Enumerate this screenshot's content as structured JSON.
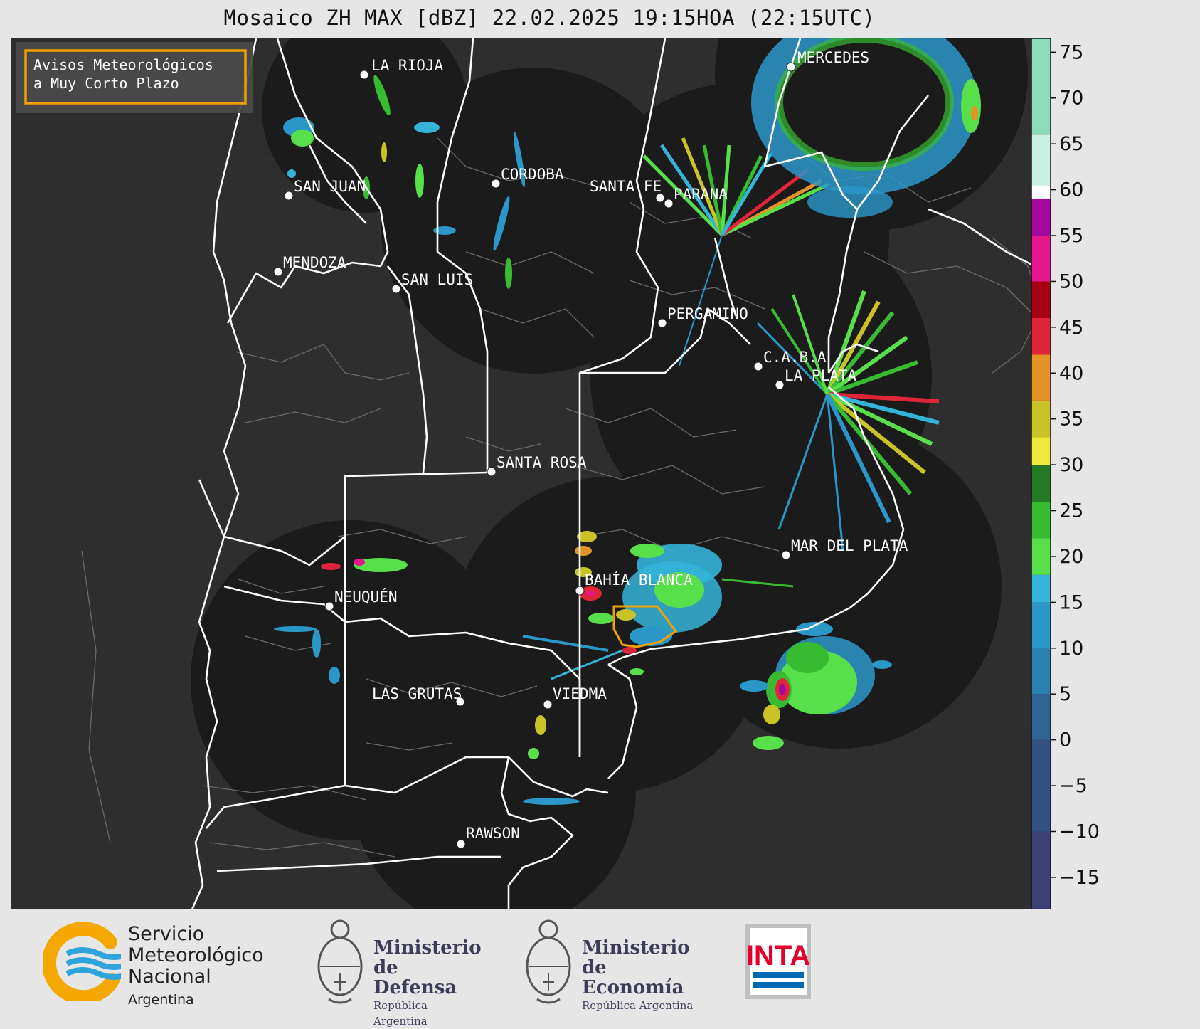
{
  "title": "Mosaico ZH MAX [dBZ] 22.02.2025 19:15HOA (22:15UTC)",
  "badge": {
    "line1": "Avisos Meteorológicos",
    "line2": "a Muy Corto Plazo",
    "color": "#f0a000"
  },
  "cities": [
    {
      "name": "LA RIOJA"
    },
    {
      "name": "SAN JUAN"
    },
    {
      "name": "CORDOBA"
    },
    {
      "name": "SANTA FE"
    },
    {
      "name": "PARANA"
    },
    {
      "name": "MERCEDES"
    },
    {
      "name": "MENDOZA"
    },
    {
      "name": "SAN LUIS"
    },
    {
      "name": "PERGAMINO"
    },
    {
      "name": "C.A.B.A"
    },
    {
      "name": "LA PLATA"
    },
    {
      "name": "SANTA ROSA"
    },
    {
      "name": "MAR DEL PLATA"
    },
    {
      "name": "BAHÍA BLANCA"
    },
    {
      "name": "NEUQUÉN"
    },
    {
      "name": "LAS GRUTAS"
    },
    {
      "name": "VIEDMA"
    },
    {
      "name": "RAWSON"
    }
  ],
  "colorbar": {
    "unit": "dBZ",
    "ticks": [
      "75",
      "70",
      "65",
      "60",
      "55",
      "50",
      "45",
      "40",
      "35",
      "30",
      "25",
      "20",
      "15",
      "10",
      "5",
      "0",
      "−5",
      "−10",
      "−15"
    ],
    "min": -18.5,
    "max": 76.5,
    "bands": [
      {
        "from": -18.5,
        "to": -10,
        "color": "#3b3f72"
      },
      {
        "from": -10,
        "to": 0,
        "color": "#34527f"
      },
      {
        "from": 0,
        "to": 5,
        "color": "#2f6594"
      },
      {
        "from": 5,
        "to": 10,
        "color": "#2c80b2"
      },
      {
        "from": 10,
        "to": 15,
        "color": "#2b97c9"
      },
      {
        "from": 15,
        "to": 18,
        "color": "#34b4d8"
      },
      {
        "from": 18,
        "to": 22,
        "color": "#58e04a"
      },
      {
        "from": 22,
        "to": 26,
        "color": "#37bb30"
      },
      {
        "from": 26,
        "to": 30,
        "color": "#237a22"
      },
      {
        "from": 30,
        "to": 33,
        "color": "#efe93a"
      },
      {
        "from": 33,
        "to": 37,
        "color": "#c9c327"
      },
      {
        "from": 37,
        "to": 42,
        "color": "#e39326"
      },
      {
        "from": 42,
        "to": 46,
        "color": "#e0243a"
      },
      {
        "from": 46,
        "to": 50,
        "color": "#a50014"
      },
      {
        "from": 50,
        "to": 55,
        "color": "#e6178c"
      },
      {
        "from": 55,
        "to": 59,
        "color": "#a5089f"
      },
      {
        "from": 59,
        "to": 60.5,
        "color": "#ffffff"
      },
      {
        "from": 60.5,
        "to": 66,
        "color": "#cbf1e3"
      },
      {
        "from": 66,
        "to": 76.5,
        "color": "#8cdcbc"
      }
    ]
  },
  "logos": {
    "smn": {
      "line1": "Servicio",
      "line2": "Meteorológico",
      "line3": "Nacional",
      "country": "Argentina",
      "ring_color": "#f5a800",
      "wave_color": "#2ea3dc"
    },
    "defensa": {
      "line1": "Ministerio",
      "line2": "de Defensa",
      "sub": "República Argentina"
    },
    "economia": {
      "line1": "Ministerio",
      "line2": "de Economía",
      "sub": "República Argentina"
    },
    "inta": {
      "text": "INTA",
      "red": "#e4002b",
      "blue": "#0069b4"
    }
  },
  "colors": {
    "map_background": "#2e2e2e",
    "radar_coverage": "#1b1b1b",
    "province_border": "#ffffff",
    "department_border": "#6a6a6a"
  }
}
